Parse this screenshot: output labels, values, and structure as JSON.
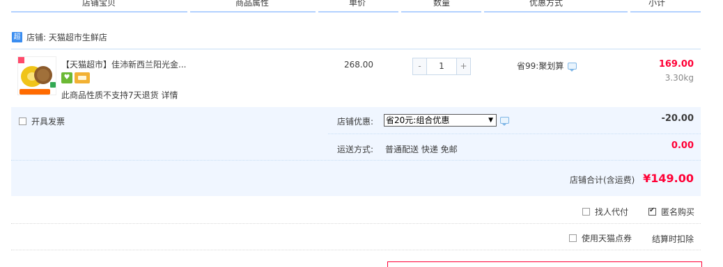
{
  "header": {
    "columns": [
      "店铺宝贝",
      "商品属性",
      "单价",
      "数量",
      "优惠方式",
      "小计"
    ]
  },
  "shop": {
    "badge": "超",
    "label": "店铺: 天猫超市生鲜店"
  },
  "item": {
    "title": "【天猫超市】佳沛新西兰阳光金...",
    "icon_green": "♥",
    "return_note": "此商品性质不支持7天退货",
    "return_link": "详情",
    "unit_price": "268.00",
    "qty_minus": "-",
    "quantity": "1",
    "qty_plus": "+",
    "discount": "省99:聚划算",
    "subtotal": "169.00",
    "weight": "3.30kg"
  },
  "summary": {
    "invoice_label": "开具发票",
    "shop_discount_label": "店铺优惠:",
    "shop_discount_selected": "省20元:组合优惠",
    "shop_discount_value": "-20.00",
    "shipping_label": "运送方式:",
    "shipping_value": "普通配送 快递 免邮",
    "shipping_fee": "0.00",
    "total_label": "店铺合计(含运费)",
    "total_value": "¥149.00"
  },
  "options": {
    "pay_for_me": "找人代付",
    "anonymous": "匿名购买",
    "anonymous_checked": true,
    "use_points": "使用天猫点券",
    "settle_note": "结算时扣除"
  },
  "colors": {
    "accent_red": "#ff0036",
    "light_blue_bg": "#f0f6ff",
    "header_line": "#b2d1ff"
  }
}
